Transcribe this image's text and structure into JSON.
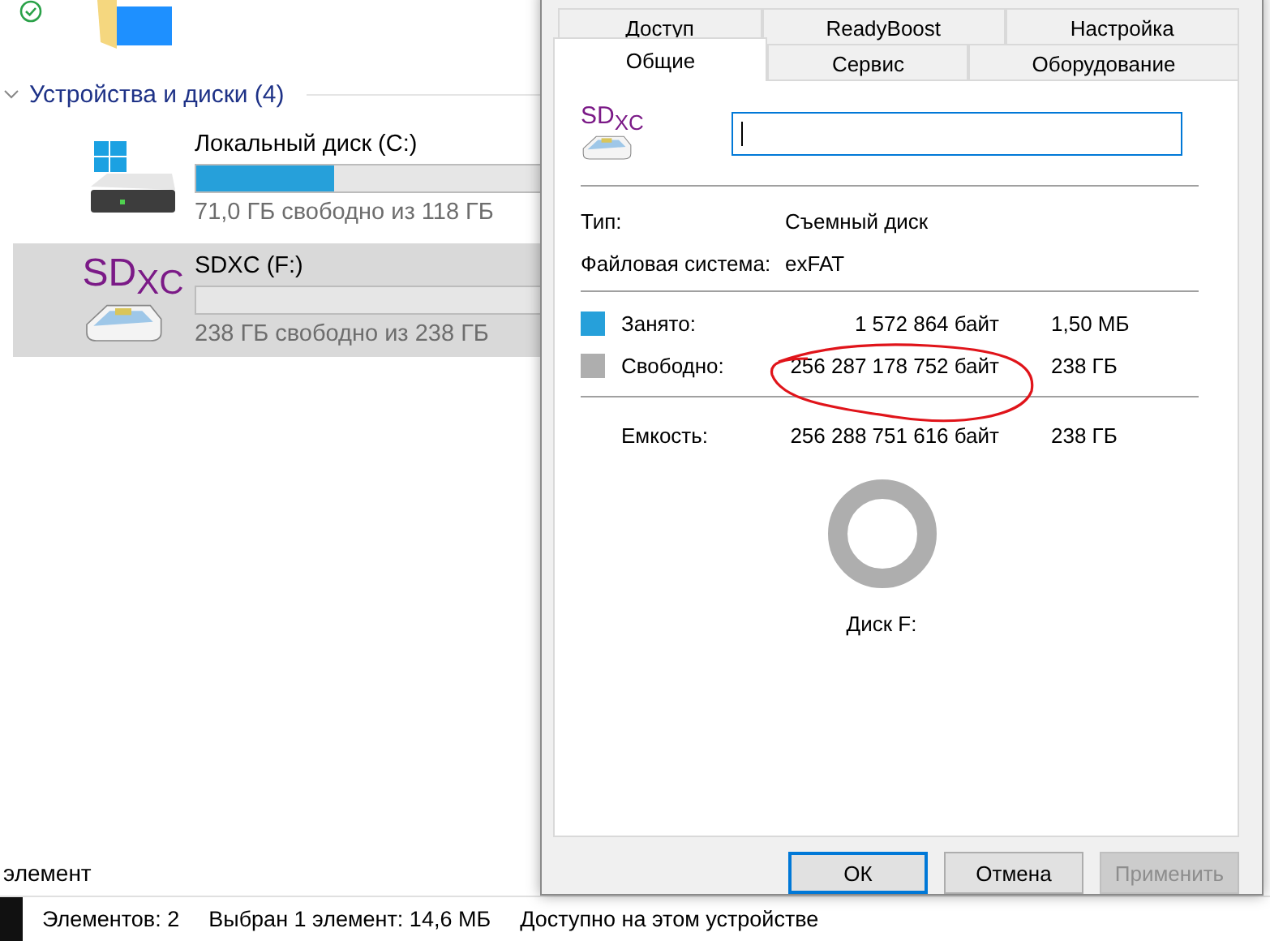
{
  "explorer": {
    "section": {
      "title": "Устройства и диски (4)",
      "expanded": true
    },
    "drives": [
      {
        "kind": "hdd",
        "name": "Локальный диск (C:)",
        "free_text": "71,0 ГБ свободно из 118 ГБ",
        "level": 0.4,
        "selected": false
      },
      {
        "kind": "sd",
        "logo_main": "SD",
        "logo_sub": "XC",
        "name": "SDXC (F:)",
        "free_text": "238 ГБ свободно из 238 ГБ",
        "level": 0,
        "selected": true
      }
    ],
    "partial_row": "элемент"
  },
  "status_bar": [
    "Элементов: 2",
    "Выбран 1 элемент: 14,6 МБ",
    "Доступно на этом устройстве"
  ],
  "dialog": {
    "tab_rows": [
      [
        {
          "label": "Доступ",
          "selected": false
        },
        {
          "label": "ReadyBoost",
          "selected": false
        },
        {
          "label": "Настройка",
          "selected": false
        }
      ],
      [
        {
          "label": "Общие",
          "selected": true
        },
        {
          "label": "Сервис",
          "selected": false
        },
        {
          "label": "Оборудование",
          "selected": false
        }
      ]
    ],
    "icon_logo": {
      "main": "SD",
      "sub": "XC"
    },
    "info": [
      {
        "label": "Тип:",
        "value": "Съемный диск"
      },
      {
        "label": "Файловая система:",
        "value": "exFAT"
      }
    ],
    "usage": [
      {
        "label": "Занято:",
        "bytes": "1 572 864 байт",
        "size": "1,50 МБ",
        "color": "#26a0da"
      },
      {
        "label": "Свободно:",
        "bytes": "256 287 178 752 байт",
        "size": "238 ГБ",
        "color": "#aeaeae"
      }
    ],
    "capacity": {
      "label": "Емкость:",
      "bytes": "256 288 751 616 байт",
      "size": "238 ГБ"
    },
    "drive_caption": "Диск F:",
    "buttons": [
      {
        "label": "ОК",
        "default": true,
        "disabled": false
      },
      {
        "label": "Отмена",
        "default": false,
        "disabled": false
      },
      {
        "label": "Применить",
        "default": false,
        "disabled": true
      }
    ]
  }
}
